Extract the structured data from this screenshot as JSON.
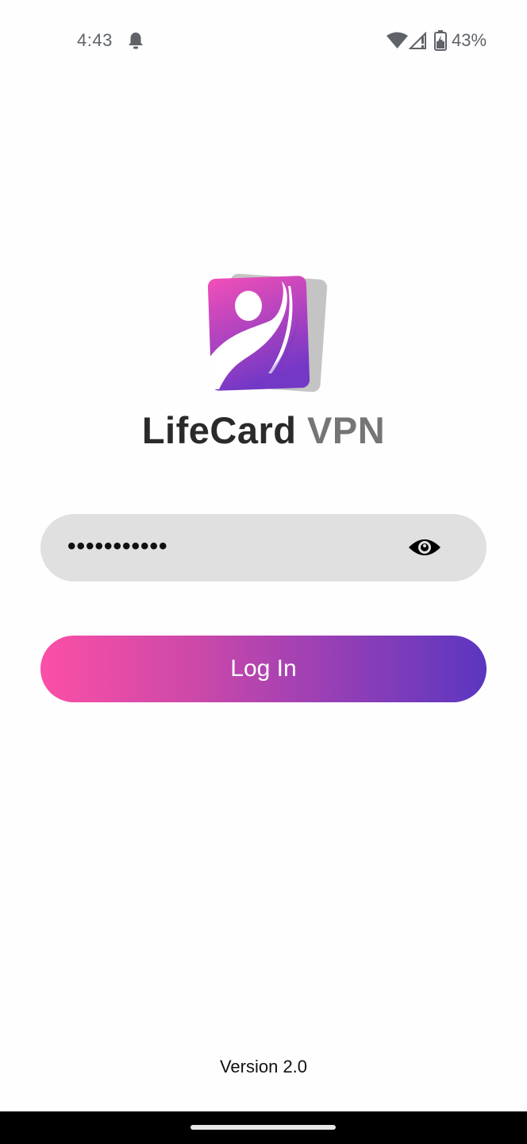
{
  "status_bar": {
    "time": "4:43",
    "battery_percent": "43%",
    "icons": [
      "bell-icon",
      "wifi-icon",
      "signal-icon",
      "battery-icon"
    ]
  },
  "brand": {
    "name_part1": "LifeCard",
    "name_part2": "VPN",
    "colors": {
      "dark": "#2a2a2a",
      "grey": "#757575",
      "pink": "#fb4fa6",
      "purple": "#5b36c0"
    }
  },
  "login_form": {
    "password_value": "•••••••••••",
    "toggle_icon": "eye-icon",
    "login_label": "Log In"
  },
  "footer": {
    "version": "Version 2.0"
  }
}
